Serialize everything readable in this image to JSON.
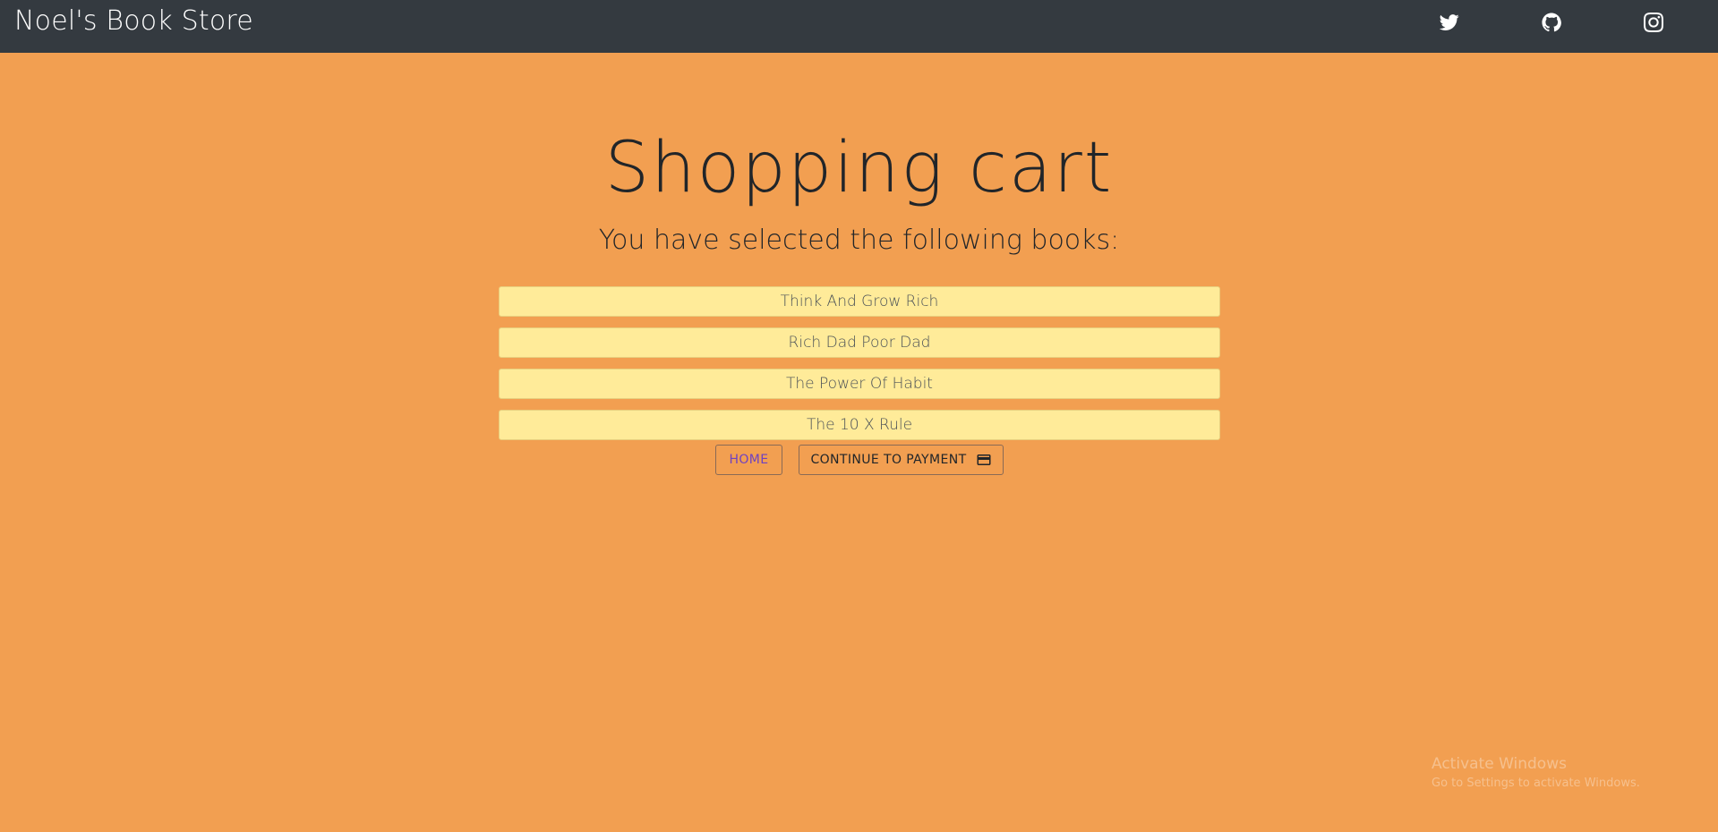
{
  "navbar": {
    "brand": "Noel's Book Store",
    "social_icons": [
      "twitter-icon",
      "github-icon",
      "instagram-icon"
    ]
  },
  "main": {
    "title": "Shopping cart",
    "subtitle": "You have selected the following books:",
    "books": [
      "Think And Grow Rich",
      "Rich Dad Poor Dad",
      "The Power Of Habit",
      "The 10 X Rule"
    ],
    "home_button": "HOME",
    "payment_button": "CONTINUE TO PAYMENT",
    "payment_icon": "credit-card-icon"
  },
  "watermark": {
    "line1": "Activate Windows",
    "line2": "Go to Settings to activate Windows."
  },
  "colors": {
    "background": "#f29f51",
    "navbar": "#343a40",
    "book_item": "#ffeb99",
    "home_text": "#6f42c1"
  }
}
